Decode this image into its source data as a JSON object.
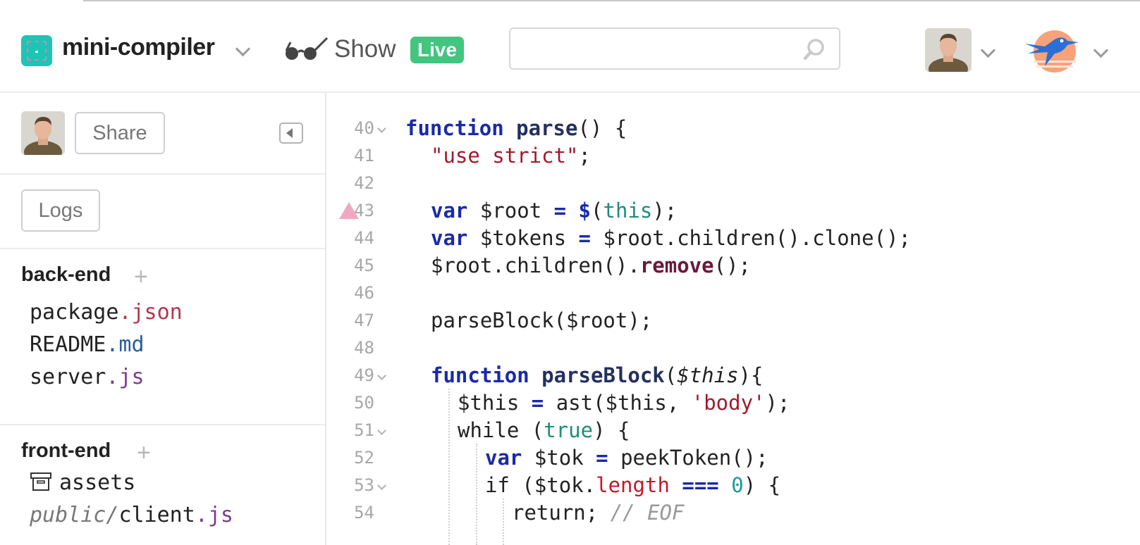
{
  "project": {
    "name": "mini-compiler"
  },
  "header": {
    "show_label": "Show",
    "live_label": "Live"
  },
  "search": {
    "value": "",
    "placeholder": ""
  },
  "sidebar": {
    "share_label": "Share",
    "logs_label": "Logs",
    "backend": {
      "title": "back-end",
      "files": [
        {
          "name": "package",
          "ext": ".json"
        },
        {
          "name": "README",
          "ext": ".md"
        },
        {
          "name": "server",
          "ext": ".js"
        }
      ]
    },
    "frontend": {
      "title": "front-end",
      "folder": "assets",
      "file": {
        "dir": "public/",
        "name": "client",
        "ext": ".js"
      }
    }
  },
  "editor": {
    "lines": [
      {
        "n": "40",
        "t": {
          "a": "function",
          "b": " ",
          "c": "parse",
          "d": "() {"
        }
      },
      {
        "n": "41",
        "t": {
          "a": "\"use strict\"",
          "b": ";"
        }
      },
      {
        "n": "42"
      },
      {
        "n": "43",
        "t": {
          "a": "var",
          "b": " $root ",
          "c": "=",
          "d": " ",
          "e": "$",
          "f": "(",
          "g": "this",
          "h": ");"
        }
      },
      {
        "n": "44",
        "t": {
          "a": "var",
          "b": " $tokens ",
          "c": "=",
          "d": " $root.children().clone();"
        }
      },
      {
        "n": "45",
        "t": {
          "a": "$root.children().",
          "b": "remove",
          "c": "();"
        }
      },
      {
        "n": "46"
      },
      {
        "n": "47",
        "t": {
          "a": "parseBlock($root);"
        }
      },
      {
        "n": "48"
      },
      {
        "n": "49",
        "t": {
          "a": "function",
          "b": " ",
          "c": "parseBlock",
          "d": "(",
          "e": "$this",
          "f": "){"
        }
      },
      {
        "n": "50",
        "t": {
          "a": "$this ",
          "b": "=",
          "c": " ast($this, ",
          "d": "'body'",
          "e": ");"
        }
      },
      {
        "n": "51",
        "t": {
          "a": "while (",
          "b": "true",
          "c": ") {"
        }
      },
      {
        "n": "52",
        "t": {
          "a": "var",
          "b": " $tok ",
          "c": "=",
          "d": " peekToken();"
        }
      },
      {
        "n": "53",
        "t": {
          "a": "if ($tok.",
          "b": "length",
          "c": " ",
          "d": "===",
          "e": " ",
          "f": "0",
          "g": ") {"
        }
      },
      {
        "n": "54",
        "t": {
          "a": "return; ",
          "b": "// EOF"
        }
      }
    ]
  }
}
